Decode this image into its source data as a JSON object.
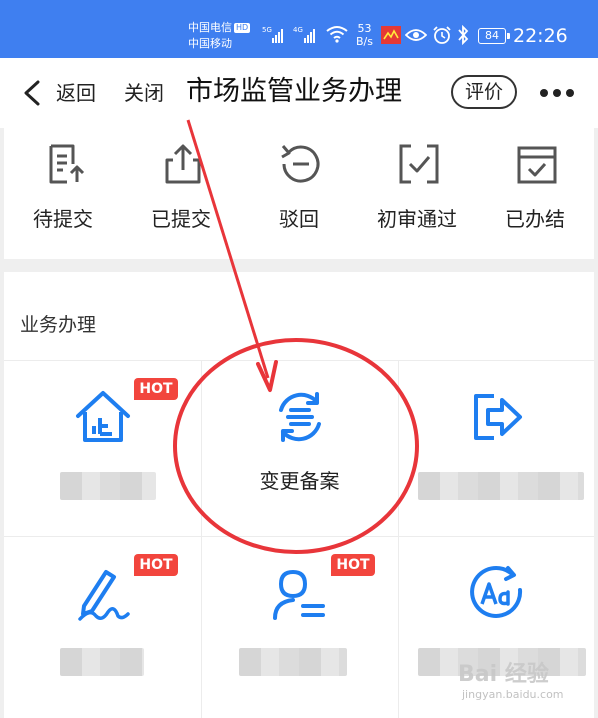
{
  "status_bar": {
    "carrier1": "中国电信",
    "carrier1_badge": "HD",
    "carrier2": "中国移动",
    "net1": "5G",
    "net2": "4G",
    "speed_value": "53",
    "speed_unit": "B/s",
    "battery": "84",
    "time": "22:26"
  },
  "nav": {
    "back_label": "返回",
    "close_label": "关闭",
    "title": "市场监管业务办理",
    "rate_label": "评价"
  },
  "status_tabs": [
    {
      "label": "待提交",
      "icon": "document-upload-icon"
    },
    {
      "label": "已提交",
      "icon": "share-upload-icon"
    },
    {
      "label": "驳回",
      "icon": "undo-circle-icon"
    },
    {
      "label": "初审通过",
      "icon": "check-box-icon"
    },
    {
      "label": "已办结",
      "icon": "calendar-check-icon"
    }
  ],
  "business": {
    "section_title": "业务办理",
    "hot_badge": "HOT",
    "items": [
      {
        "label": "",
        "icon": "house-up-icon",
        "hot": true
      },
      {
        "label": "变更备案",
        "icon": "change-record-icon",
        "hot": false
      },
      {
        "label": "",
        "icon": "exit-arrow-icon",
        "hot": false
      },
      {
        "label": "",
        "icon": "pen-signature-icon",
        "hot": true
      },
      {
        "label": "",
        "icon": "person-list-icon",
        "hot": true
      },
      {
        "label": "",
        "icon": "text-refresh-icon",
        "hot": false
      }
    ]
  },
  "colors": {
    "status_bar": "#3f7ff0",
    "accent_blue": "#1e7ef0",
    "hot_red": "#f2453d",
    "annotation_red": "#e8353a"
  },
  "watermark": {
    "text": "Bai 经验",
    "sub": "jingyan.baidu.com"
  }
}
